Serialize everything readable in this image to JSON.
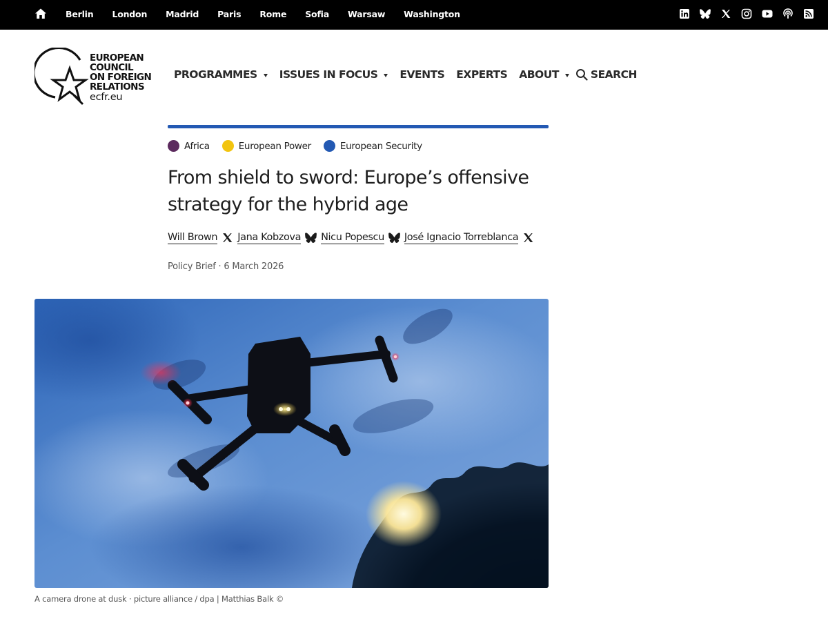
{
  "topbar": {
    "home_icon": "home-icon",
    "cities": [
      "Berlin",
      "London",
      "Madrid",
      "Paris",
      "Rome",
      "Sofia",
      "Warsaw",
      "Washington"
    ],
    "social_icons": [
      "linkedin-icon",
      "bluesky-icon",
      "x-icon",
      "instagram-icon",
      "youtube-icon",
      "podcast-icon",
      "rss-icon"
    ]
  },
  "logo": {
    "line1": "EUROPEAN",
    "line2": "COUNCIL",
    "line3": "ON FOREIGN",
    "line4": "RELATIONS",
    "url": "ecfr.eu"
  },
  "nav": {
    "programmes": "PROGRAMMES",
    "issues": "ISSUES IN FOCUS",
    "events": "EVENTS",
    "experts": "EXPERTS",
    "about": "ABOUT",
    "search": "SEARCH"
  },
  "tags": [
    {
      "label": "Africa",
      "color": "#5c2a5e"
    },
    {
      "label": "European Power",
      "color": "#f2c40f"
    },
    {
      "label": "European Security",
      "color": "#2359b3"
    }
  ],
  "article": {
    "title": "From shield to sword: Europe’s offensive strategy for the hybrid age",
    "authors": [
      {
        "name": "Will Brown",
        "icon": "x-icon"
      },
      {
        "name": "Jana Kobzova",
        "icon": "bluesky-icon"
      },
      {
        "name": "Nicu Popescu",
        "icon": "bluesky-icon"
      },
      {
        "name": "José Ignacio Torreblanca",
        "icon": "x-icon"
      }
    ],
    "meta": "Policy Brief · 6 March 2026",
    "image_caption": "A camera drone at dusk · picture alliance / dpa | Matthias Balk ©"
  },
  "colors": {
    "accent": "#2359b3",
    "topbar_bg": "#000000"
  }
}
